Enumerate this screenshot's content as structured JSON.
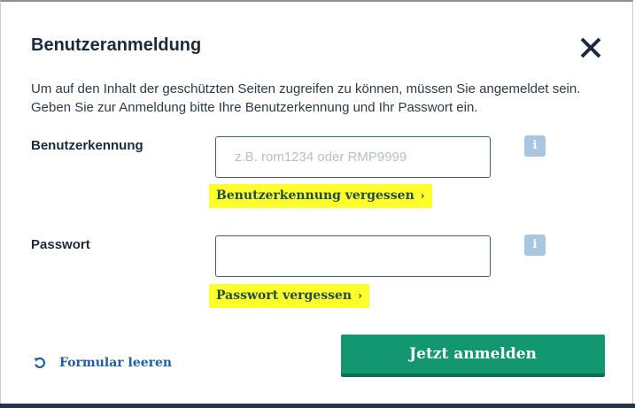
{
  "dialog": {
    "title": "Benutzeranmeldung",
    "intro_line1": "Um auf den Inhalt der geschützten Seiten zugreifen zu können, müssen Sie angemeldet sein.",
    "intro_line2": "Geben Sie zur Anmeldung bitte Ihre Benutzerkennung und Ihr Passwort ein."
  },
  "username": {
    "label": "Benutzerkennung",
    "placeholder": "z.B. rom1234 oder RMP9999",
    "value": "",
    "info_icon": "i",
    "forgot_label": "Benutzerkennung vergessen",
    "forgot_chevron": "›"
  },
  "password": {
    "label": "Passwort",
    "placeholder": "",
    "value": "",
    "info_icon": "i",
    "forgot_label": "Passwort vergessen",
    "forgot_chevron": "›"
  },
  "actions": {
    "reset_label": "Formular leeren",
    "submit_label": "Jetzt anmelden"
  },
  "icons": {
    "close": "close-icon",
    "info": "info-icon",
    "reset": "undo-icon"
  },
  "colors": {
    "highlight": "#ffff2a",
    "submit": "#139771",
    "link": "#1e5f9f",
    "info": "#a9c6e0",
    "heading": "#1c2b3a"
  }
}
